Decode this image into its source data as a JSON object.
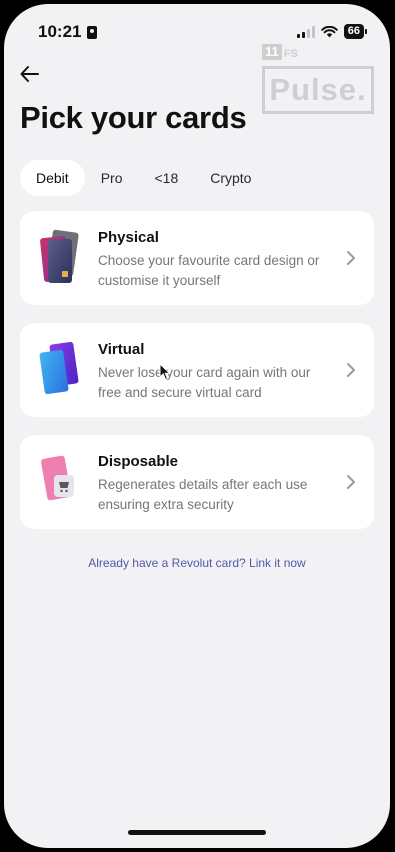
{
  "status_bar": {
    "time": "10:21",
    "battery": "66"
  },
  "watermark": {
    "brand_num": "11",
    "brand_suffix": "FS",
    "word": "Pulse."
  },
  "header": {
    "title": "Pick your cards"
  },
  "tabs": [
    {
      "label": "Debit",
      "active": true
    },
    {
      "label": "Pro",
      "active": false
    },
    {
      "label": "<18",
      "active": false
    },
    {
      "label": "Crypto",
      "active": false
    }
  ],
  "card_options": [
    {
      "title": "Physical",
      "description": "Choose your favourite card design or customise it yourself",
      "icon": "physical-card-icon"
    },
    {
      "title": "Virtual",
      "description": "Never lose your card again with our free and secure virtual card",
      "icon": "virtual-card-icon"
    },
    {
      "title": "Disposable",
      "description": "Regenerates details after each use ensuring extra security",
      "icon": "disposable-card-icon"
    }
  ],
  "footer": {
    "link_text": "Already have a Revolut card? Link it now"
  },
  "colors": {
    "background": "#f2f2f4",
    "card": "#ffffff",
    "link": "#5457a8",
    "muted_text": "#75767d"
  }
}
